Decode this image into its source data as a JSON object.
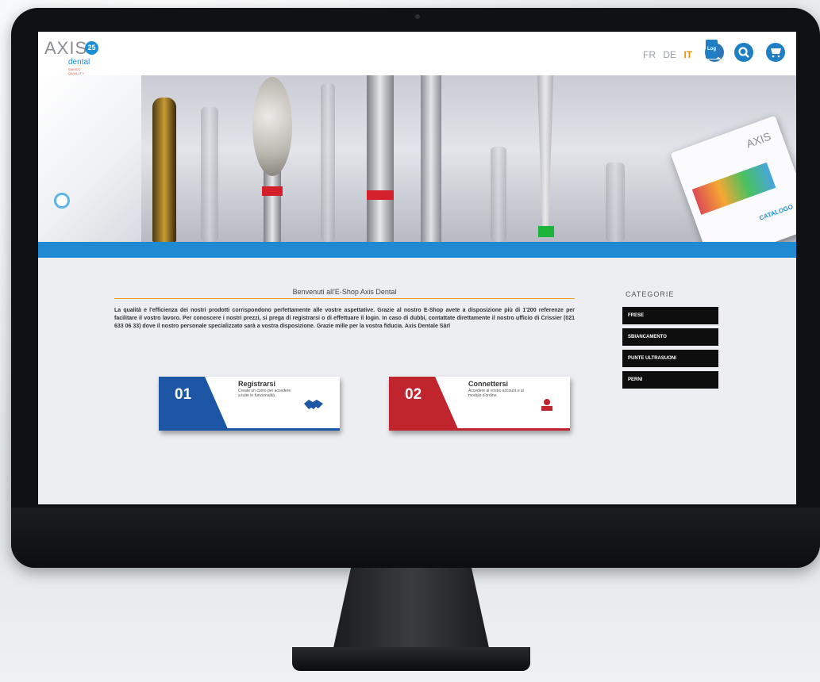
{
  "header": {
    "logo": {
      "word": "AXIS",
      "badge": "25",
      "sub": "dental",
      "tagline": "SWISS QUALITY"
    },
    "languages": [
      {
        "code": "FR",
        "active": false
      },
      {
        "code": "DE",
        "active": false
      },
      {
        "code": "IT",
        "active": true
      }
    ],
    "icons": {
      "account": "user-icon",
      "account_tag": "Log",
      "search": "search-icon",
      "cart": "cart-icon"
    }
  },
  "hero": {
    "catalog_brand": "AXIS",
    "catalog_label": "CATALOGO"
  },
  "welcome": {
    "title": "Benvenuti all'E-Shop Axis Dental",
    "text": "La qualità e l'efficienza dei nostri prodotti corrispondono perfettamente alle vostre aspettative. Grazie al nostro E-Shop avete a disposizione più di 1'200 referenze per facilitare il vostro lavoro. Per conoscere i nostri prezzi, si prega di registrarsi o di effettuare il login. In caso di dubbi, contattate direttamente il nostro ufficio di Crissier (021 633 06 33) dove il nostro personale specializzato sarà a vostra disposizione. Grazie mille per la vostra fiducia. Axis Dentale Sàrl"
  },
  "cards": [
    {
      "number": "01",
      "title": "Registrarsi",
      "desc": "Create un conto per accedere a tutte le funzionalità.",
      "icon": "handshake-icon",
      "color": "#1d56a5"
    },
    {
      "number": "02",
      "title": "Connettersi",
      "desc": "Accedere al vostro account e al modulo d'ordine.",
      "icon": "user-icon",
      "color": "#c0242d"
    }
  ],
  "categories": {
    "title": "CATEGORIE",
    "items": [
      "FRESE",
      "SBIANCAMENTO",
      "PUNTE ULTRASUONI",
      "PERNI"
    ]
  }
}
